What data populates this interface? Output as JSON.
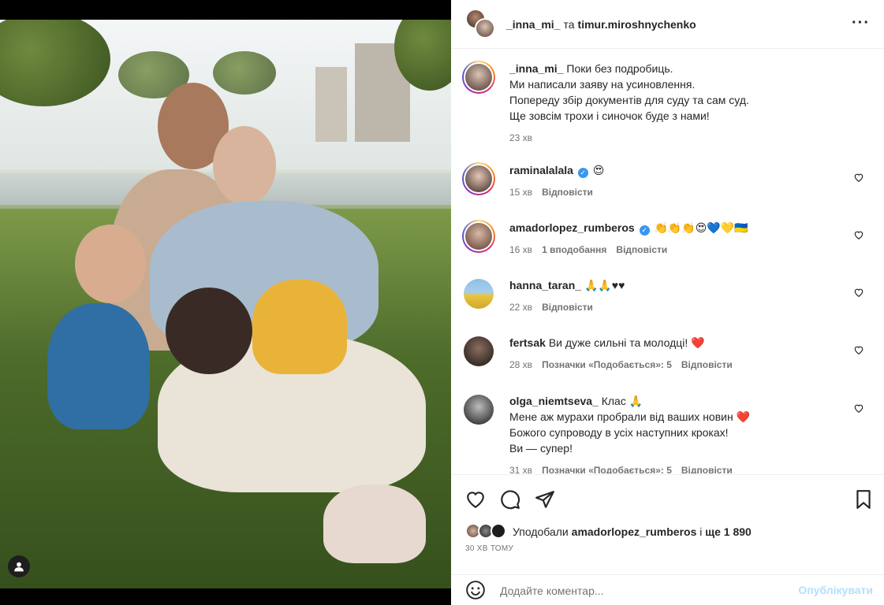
{
  "header": {
    "user1": "_inna_mi_",
    "connector": "та",
    "user2": "timur.miroshnychenko",
    "more_icon": "more-horizontal-icon"
  },
  "caption": {
    "user": "_inna_mi_",
    "line1": "Поки без подробиць.",
    "line2": "Ми написали заяву на усиновлення.",
    "line3": "Попереду збір документів для суду та сам суд.",
    "line4": "Ще зовсім трохи і синочок буде з нами!",
    "time": "23 хв"
  },
  "comments": [
    {
      "user": "raminalalala",
      "verified": true,
      "text": "😍",
      "time": "15 хв",
      "likes": "",
      "reply": "Відповісти"
    },
    {
      "user": "amadorlopez_rumberos",
      "verified": true,
      "text": "👏👏👏😍💙💛🇺🇦",
      "time": "16 хв",
      "likes": "1 вподобання",
      "reply": "Відповісти"
    },
    {
      "user": "hanna_taran_",
      "verified": false,
      "text": "🙏🙏♥♥",
      "time": "22 хв",
      "likes": "",
      "reply": "Відповісти"
    },
    {
      "user": "fertsak",
      "verified": false,
      "text": "Ви дуже сильні та молодці! ❤️",
      "time": "28 хв",
      "likes": "Позначки «Подобається»: 5",
      "reply": "Відповісти"
    },
    {
      "user": "olga_niemtseva_",
      "verified": false,
      "text": "Клас 🙏",
      "line2": "Мене аж мурахи пробрали від ваших новин ❤️",
      "line3": "Божого супроводу в усіх наступних кроках!",
      "line4": "Ви — супер!",
      "time": "31 хв",
      "likes": "Позначки «Подобається»: 5",
      "reply": "Відповісти"
    }
  ],
  "likes": {
    "prefix": "Уподобали",
    "user": "amadorlopez_rumberos",
    "connector": "і",
    "rest": "ще 1 890"
  },
  "time_ago": "30 ХВ ТОМУ",
  "add_comment": {
    "placeholder": "Додайте коментар...",
    "publish_label": "Опублікувати"
  },
  "colors": {
    "verified": "#3897f0",
    "publish_disabled": "#b2dffc",
    "heart_red": "#ed4956"
  }
}
